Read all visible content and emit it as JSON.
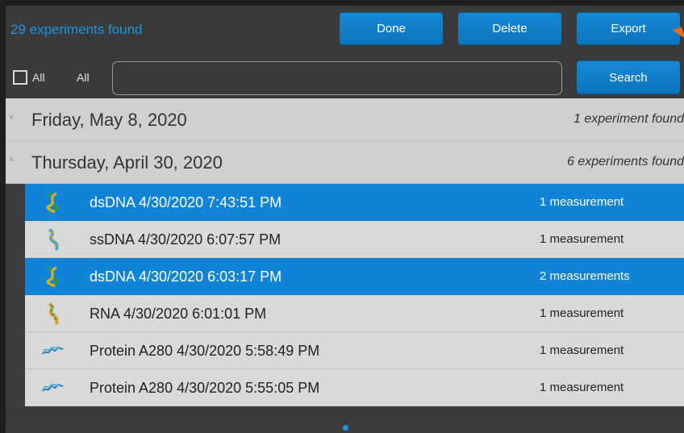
{
  "header": {
    "found_text": "29 experiments found",
    "done_label": "Done",
    "delete_label": "Delete",
    "export_label": "Export"
  },
  "search": {
    "all_checkbox_label": "All",
    "filter_label": "All",
    "value": "",
    "placeholder": "",
    "button_label": "Search"
  },
  "groups": [
    {
      "date": "Friday, May 8, 2020",
      "count": "1 experiment found",
      "chevron": "˅"
    },
    {
      "date": "Thursday, April 30, 2020",
      "count": "6 experiments found",
      "chevron": "˄"
    }
  ],
  "rows": [
    {
      "name": "dsDNA 4/30/2020 7:43:51 PM",
      "measurements": "1 measurement",
      "icon": "dsdna-icon",
      "selected": true
    },
    {
      "name": "ssDNA 4/30/2020 6:07:57 PM",
      "measurements": "1 measurement",
      "icon": "ssdna-icon",
      "selected": false
    },
    {
      "name": "dsDNA 4/30/2020 6:03:17 PM",
      "measurements": "2 measurements",
      "icon": "dsdna-icon",
      "selected": true
    },
    {
      "name": "RNA 4/30/2020 6:01:01 PM",
      "measurements": "1 measurement",
      "icon": "rna-icon",
      "selected": false
    },
    {
      "name": "Protein A280 4/30/2020 5:58:49 PM",
      "measurements": "1 measurement",
      "icon": "protein-icon",
      "selected": false
    },
    {
      "name": "Protein A280 4/30/2020 5:55:05 PM",
      "measurements": "1 measurement",
      "icon": "protein-icon",
      "selected": false
    }
  ],
  "colors": {
    "accent": "#1184d7",
    "header_text": "#1e94e0",
    "group_bg": "#d0d0d0",
    "row_bg": "#d9d9d9",
    "export_marker": "#e36b1b"
  },
  "pager": {
    "current_page": 1
  }
}
